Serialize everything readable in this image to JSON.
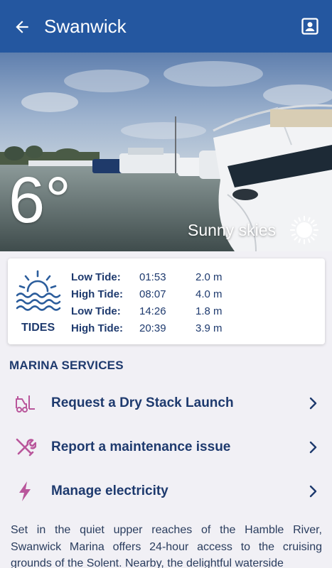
{
  "appbar": {
    "title": "Swanwick"
  },
  "hero": {
    "temperature": "6°",
    "weather": "Sunny skies"
  },
  "tides": {
    "label": "TIDES",
    "rows": [
      {
        "name": "Low Tide:",
        "time": "01:53",
        "height": "2.0 m"
      },
      {
        "name": "High Tide:",
        "time": "08:07",
        "height": "4.0 m"
      },
      {
        "name": "Low Tide:",
        "time": "14:26",
        "height": "1.8 m"
      },
      {
        "name": "High Tide:",
        "time": "20:39",
        "height": "3.9 m"
      }
    ]
  },
  "services": {
    "title": "MARINA SERVICES",
    "items": [
      {
        "label": "Request a Dry Stack Launch",
        "icon": "forklift-icon"
      },
      {
        "label": "Report a maintenance issue",
        "icon": "tools-icon"
      },
      {
        "label": "Manage electricity",
        "icon": "lightning-icon"
      }
    ]
  },
  "description": "Set in the quiet upper reaches of the Hamble River, Swanwick Marina offers 24-hour access to the cruising grounds of the Solent. Nearby, the delightful waterside",
  "colors": {
    "appbar": "#2457a0",
    "text_primary": "#1e3a6e",
    "icon_accent": "#b9569b",
    "background": "#f1f0f5"
  }
}
